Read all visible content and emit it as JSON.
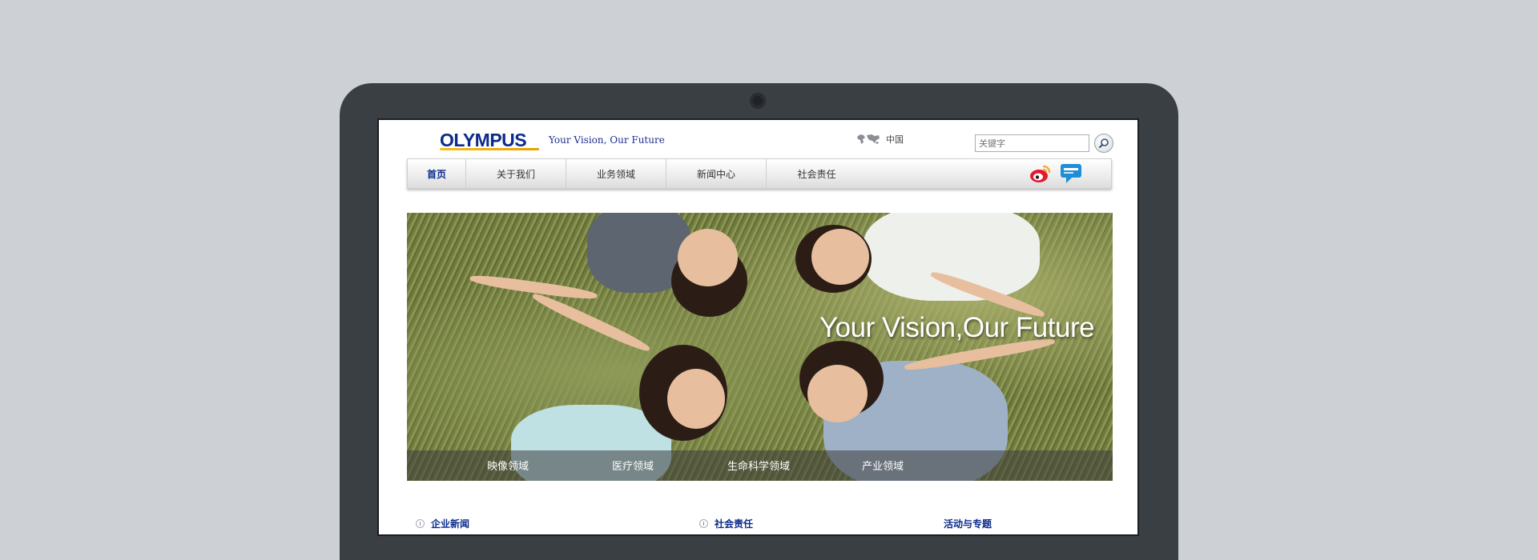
{
  "header": {
    "logo": "OLYMPUS",
    "tagline": "Your Vision, Our Future",
    "region": "中国",
    "search_placeholder": "关键字"
  },
  "nav": {
    "items": [
      "首页",
      "关于我们",
      "业务领域",
      "新闻中心",
      "社会责任"
    ]
  },
  "banner": {
    "title": "Your Vision,Our Future",
    "links": [
      "映像领域",
      "医疗领域",
      "生命科学领域",
      "产业领域"
    ]
  },
  "sections": [
    "企业新闻",
    "社会责任",
    "活动与专题"
  ],
  "icons": {
    "region": "world-map-icon",
    "search": "search-icon",
    "weibo": "weibo-icon",
    "chat": "chat-bubble-icon"
  },
  "colors": {
    "brand": "#0a2a8c",
    "logo_bar": "#f2c01a",
    "laptop_bezel": "#3a3f44",
    "page_bg": "#cdd0d5"
  }
}
